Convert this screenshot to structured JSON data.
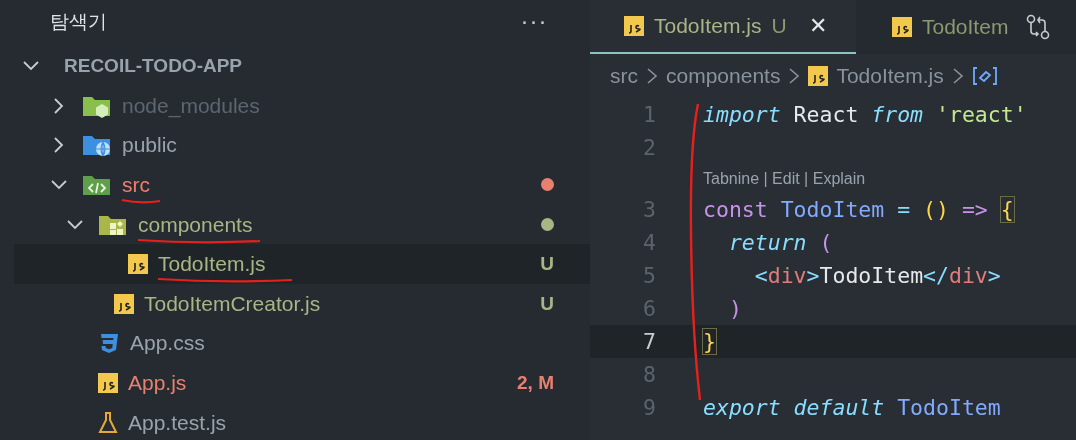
{
  "sidebar": {
    "title": "탐색기",
    "more": "···",
    "root": {
      "label": "RECOIL-TODO-APP",
      "expanded": true
    },
    "tree": [
      {
        "name": "node_modules",
        "kind": "folder-node",
        "expanded": false,
        "color": "#5e666d"
      },
      {
        "name": "public",
        "kind": "folder-globe",
        "expanded": false,
        "color": "#9aa3ab"
      },
      {
        "name": "src",
        "kind": "folder-code",
        "expanded": true,
        "color": "#e8806f",
        "dot": true,
        "underlined": true,
        "children": [
          {
            "name": "components",
            "kind": "folder-components",
            "expanded": true,
            "color": "#a9b585",
            "dot": true,
            "underlined": true,
            "children": [
              {
                "name": "TodoItem.js",
                "kind": "js",
                "color": "#a9b585",
                "badge": "U",
                "selected": true,
                "underlined": true
              },
              {
                "name": "TodoItemCreator.js",
                "kind": "js",
                "color": "#a9b585",
                "badge": "U",
                "selected": false
              }
            ]
          },
          {
            "name": "App.css",
            "kind": "css",
            "color": "#9aa3ab",
            "selected": false
          },
          {
            "name": "App.js",
            "kind": "js",
            "color": "#e8806f",
            "badge": "2, M",
            "selected": false
          },
          {
            "name": "App.test.js",
            "kind": "flask",
            "color": "#9aa3ab",
            "selected": false
          }
        ]
      }
    ]
  },
  "tabs": [
    {
      "label": "TodoItem.js",
      "badge": "U",
      "close": "✕",
      "selected": true
    },
    {
      "label": "TodoItem",
      "selected": false
    }
  ],
  "breadcrumbs": [
    {
      "label": "src",
      "kind": "folder"
    },
    {
      "label": "components",
      "kind": "folder"
    },
    {
      "label": "TodoItem.js",
      "kind": "js"
    }
  ],
  "editor": {
    "annotated": true,
    "lines": [
      {
        "number": "1",
        "current": false,
        "tokens": [
          {
            "text": "import",
            "kind": "keyword"
          },
          {
            "text": " React ",
            "kind": "plain"
          },
          {
            "text": "from",
            "kind": "keyword"
          },
          {
            "text": " 'react'",
            "kind": "string"
          }
        ]
      },
      {
        "number": "2",
        "current": false
      },
      {
        "codelens": "Tabnine | Edit | Explain"
      },
      {
        "number": "3",
        "current": false,
        "tokens": [
          {
            "text": "const ",
            "kind": "storage"
          },
          {
            "text": "TodoItem",
            "kind": "name"
          },
          {
            "text": " = ",
            "kind": "operator"
          },
          {
            "text": "()",
            "kind": "bracket"
          },
          {
            "text": " => ",
            "kind": "storage"
          },
          {
            "text": "{",
            "kind": "bracket-match"
          }
        ]
      },
      {
        "number": "4",
        "current": false,
        "tokens": [
          {
            "text": "  return",
            "kind": "keyword"
          },
          {
            "text": " (",
            "kind": "paren"
          }
        ]
      },
      {
        "number": "5",
        "current": false,
        "tokens": [
          {
            "text": "    <",
            "kind": "tag-punct"
          },
          {
            "text": "div",
            "kind": "tag"
          },
          {
            "text": ">",
            "kind": "tag-punct"
          },
          {
            "text": "TodoItem",
            "kind": "plain"
          },
          {
            "text": "</",
            "kind": "tag-punct"
          },
          {
            "text": "div",
            "kind": "tag"
          },
          {
            "text": ">",
            "kind": "tag-punct"
          }
        ]
      },
      {
        "number": "6",
        "current": false,
        "tokens": [
          {
            "text": "  )",
            "kind": "paren"
          }
        ]
      },
      {
        "number": "7",
        "current": true,
        "tokens": [
          {
            "text": "}",
            "kind": "bracket-match"
          }
        ]
      },
      {
        "number": "8",
        "current": false
      },
      {
        "number": "9",
        "current": false,
        "tokens": [
          {
            "text": "export default ",
            "kind": "keyword"
          },
          {
            "text": "TodoItem",
            "kind": "name"
          }
        ]
      }
    ]
  }
}
